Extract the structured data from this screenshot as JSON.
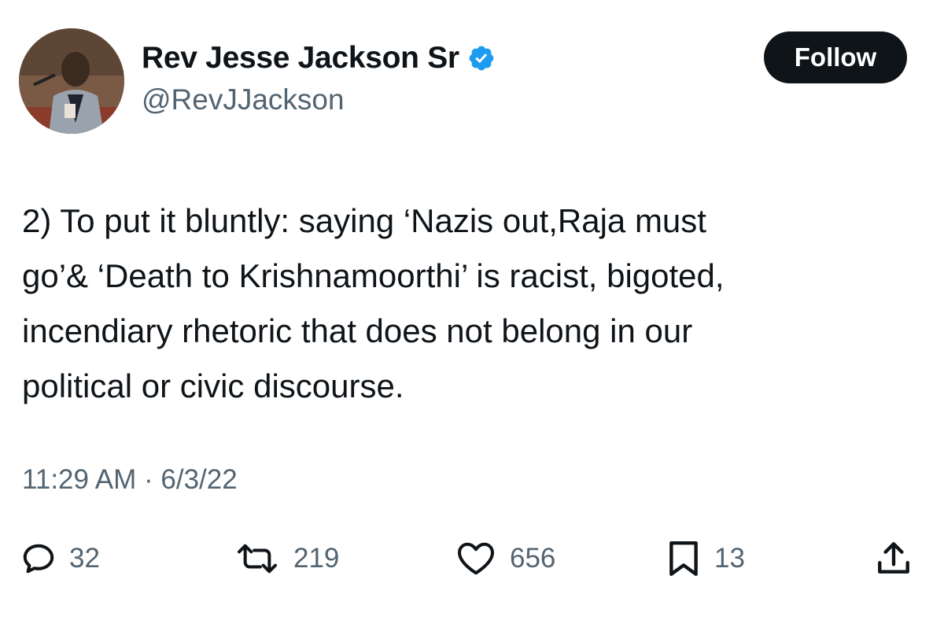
{
  "author": {
    "display_name": "Rev Jesse Jackson Sr",
    "handle": "@RevJJackson",
    "verified": true
  },
  "follow_button": {
    "label": "Follow"
  },
  "tweet": {
    "lines": [
      "2) To put it bluntly: saying ‘Nazis out,Raja must",
      "go’& ‘Death to Krishnamoorthi’ is racist, bigoted,",
      "incendiary rhetoric that does not belong in our",
      "political or civic discourse."
    ],
    "time": "11:29 AM",
    "separator": "·",
    "date": "6/3/22"
  },
  "actions": {
    "replies": "32",
    "retweets": "219",
    "likes": "656",
    "bookmarks": "13"
  },
  "colors": {
    "text_primary": "#0f1419",
    "text_secondary": "#536471",
    "verified_blue": "#1d9bf0",
    "follow_bg": "#0f1419"
  },
  "icons": {
    "reply": "reply-icon",
    "retweet": "retweet-icon",
    "like": "heart-icon",
    "bookmark": "bookmark-icon",
    "share": "share-icon",
    "verified": "verified-badge-icon"
  }
}
